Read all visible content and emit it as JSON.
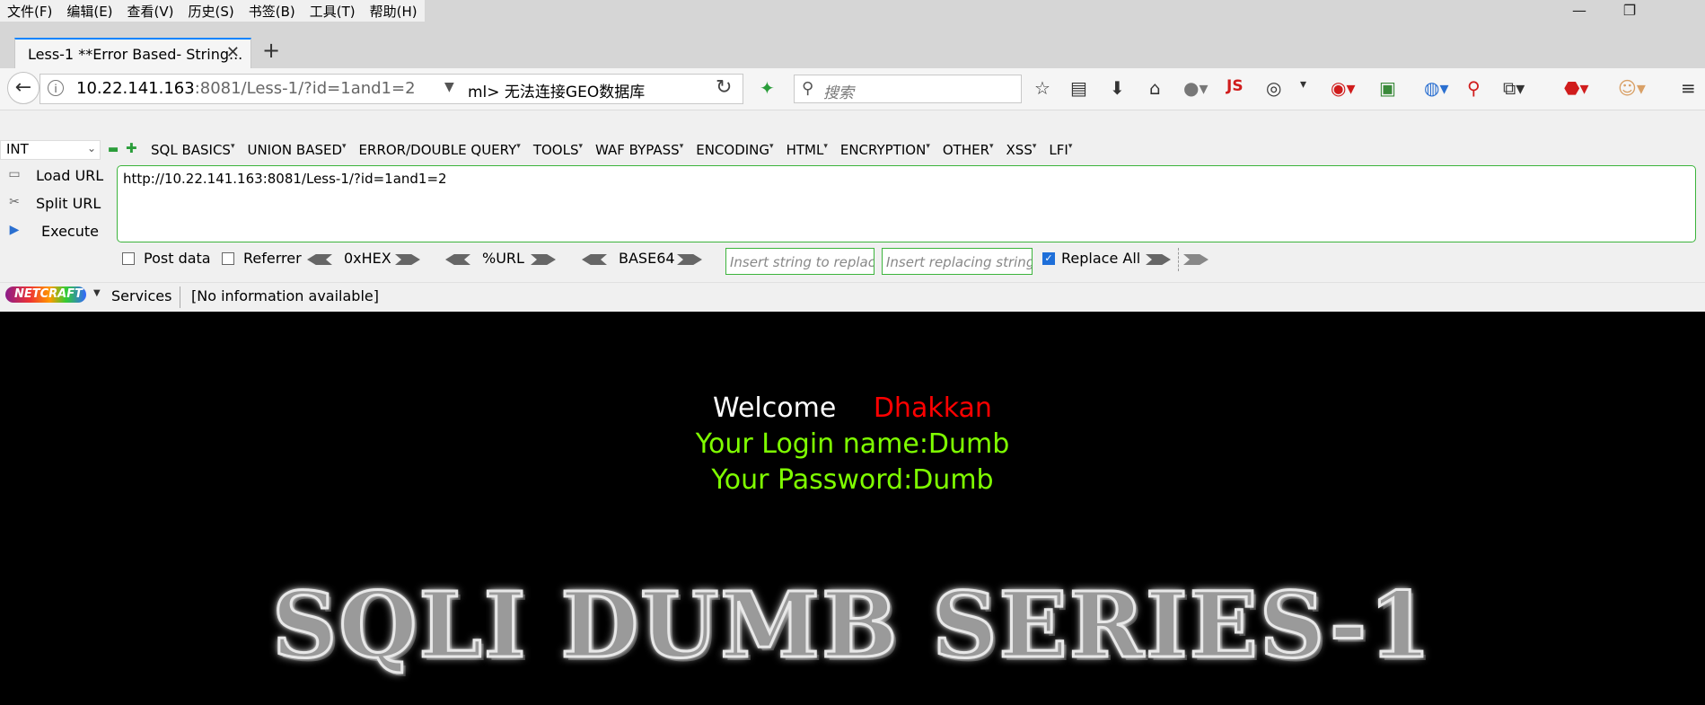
{
  "menu": [
    "文件(F)",
    "编辑(E)",
    "查看(V)",
    "历史(S)",
    "书签(B)",
    "工具(T)",
    "帮助(H)"
  ],
  "window_controls": {
    "minimize": "—",
    "restore": "❐",
    "close": ""
  },
  "tab": {
    "title": "Less-1 **Error Based- String...",
    "close": "✕",
    "new": "+"
  },
  "nav": {
    "url_host": "10.22.141.163",
    "url_rest": ":8081/Less-1/?id=1and1=2",
    "geo_text": "ml>   无法连接GEO数据库",
    "search_placeholder": "搜索"
  },
  "toolbar_icons": [
    "star-icon",
    "clipboard-icon",
    "download-icon",
    "home-icon",
    "globe-icon",
    "js-icon",
    "palette-icon",
    "stop-icon",
    "image-icon",
    "browser-icon",
    "zoom-icon",
    "share-icon",
    "adblock-icon",
    "face-icon",
    "hamburger-icon"
  ],
  "hackbar": {
    "select_value": "INT",
    "menus": [
      "SQL BASICS",
      "UNION BASED",
      "ERROR/DOUBLE QUERY",
      "TOOLS",
      "WAF BYPASS",
      "ENCODING",
      "HTML",
      "ENCRYPTION",
      "OTHER",
      "XSS",
      "LFI"
    ],
    "side": {
      "load": "Load URL",
      "split": "Split URL",
      "execute": "Execute"
    },
    "url_value": "http://10.22.141.163:8081/Less-1/?id=1and1=2",
    "post_data": "Post data",
    "referrer": "Referrer",
    "hex": "0xHEX",
    "urlenc": "%URL",
    "base64": "BASE64",
    "replace_placeholder": "Insert string to replace",
    "replacing_placeholder": "Insert replacing string",
    "replace_all": "Replace All"
  },
  "netcraft": {
    "logo": "NETCRAFT",
    "services": "Services",
    "info": "[No information available]"
  },
  "page": {
    "welcome": "Welcome",
    "name": "Dhakkan",
    "login": "Your Login name:Dumb",
    "password": "Your Password:Dumb",
    "banner": "SQLI DUMB SERIES-1"
  },
  "colors": {
    "welcome_name": "#ff0000",
    "login_text": "#7fff00",
    "background": "#000000",
    "accent": "#3cb43c"
  }
}
